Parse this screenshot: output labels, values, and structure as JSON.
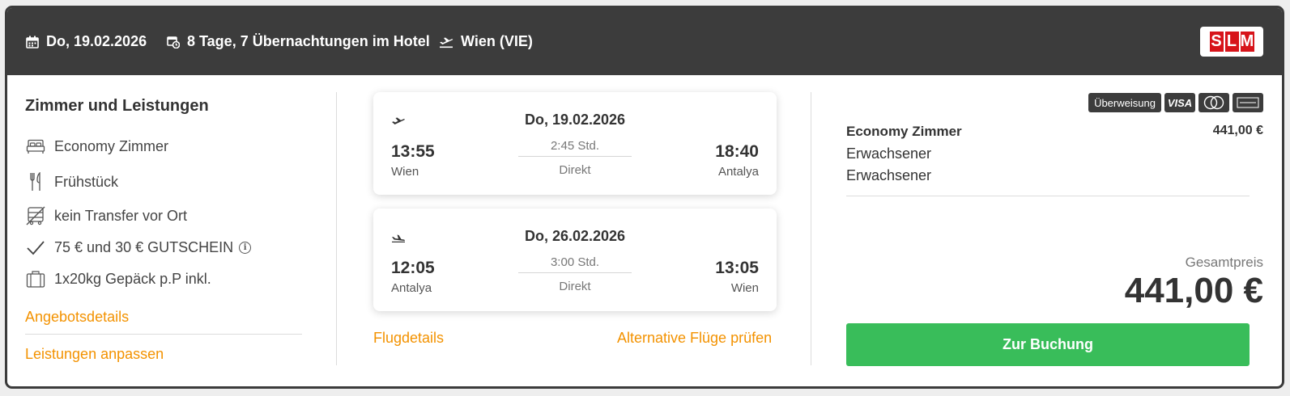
{
  "header": {
    "date": "Do, 19.02.2026",
    "duration": "8 Tage, 7 Übernachtungen im Hotel",
    "airport": "Wien (VIE)",
    "logo_letters": [
      "S",
      "L",
      "M"
    ]
  },
  "services": {
    "title": "Zimmer und Leistungen",
    "items": [
      {
        "icon": "bed-icon",
        "label": "Economy Zimmer"
      },
      {
        "icon": "cutlery-icon",
        "label": "Frühstück"
      },
      {
        "icon": "no-transfer-icon",
        "label": "kein Transfer vor Ort"
      },
      {
        "icon": "checkmark-icon",
        "label": "75 € und 30 € GUTSCHEIN"
      },
      {
        "icon": "luggage-icon",
        "label": "1x20kg Gepäck p.P inkl."
      }
    ],
    "offer_details_link": "Angebotsdetails",
    "adjust_link": "Leistungen anpassen"
  },
  "flights": [
    {
      "date": "Do, 19.02.2026",
      "dep_time": "13:55",
      "dep_city": "Wien",
      "duration": "2:45 Std.",
      "stops": "Direkt",
      "arr_time": "18:40",
      "arr_city": "Antalya"
    },
    {
      "date": "Do, 26.02.2026",
      "dep_time": "12:05",
      "dep_city": "Antalya",
      "duration": "3:00 Std.",
      "stops": "Direkt",
      "arr_time": "13:05",
      "arr_city": "Wien"
    }
  ],
  "flight_links": {
    "details": "Flugdetails",
    "alternatives": "Alternative Flüge prüfen"
  },
  "payment_methods": [
    "Überweisung",
    "VISA",
    "MasterCard",
    "AMERICAN EXPRESS"
  ],
  "booking": {
    "room": "Economy Zimmer",
    "room_price": "441,00 €",
    "travellers": [
      "Erwachsener",
      "Erwachsener"
    ],
    "total_label": "Gesamtpreis",
    "total_price": "441,00 €",
    "button": "Zur Buchung"
  },
  "colors": {
    "header_bg": "#3c3c3c",
    "link_orange": "#f39200",
    "button_green": "#39bd5a",
    "logo_red": "#d7141a"
  }
}
